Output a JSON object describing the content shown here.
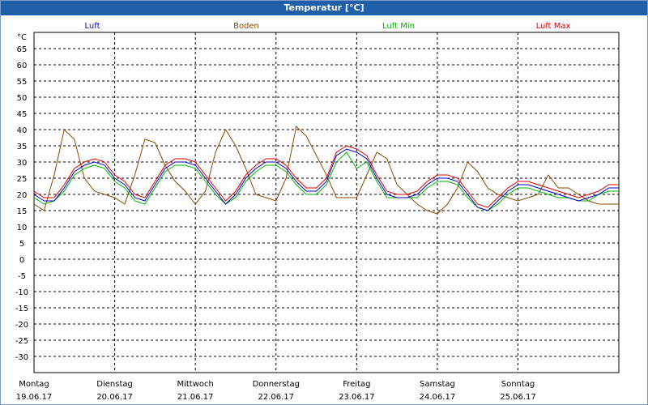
{
  "window": {
    "title": "Temperatur [°C]"
  },
  "colors": {
    "Luft": "#0000cc",
    "Boden": "#8b4a00",
    "Luft Min": "#00b400",
    "Luft Max": "#dd0000"
  },
  "chart_data": {
    "type": "line",
    "title": "Temperatur [°C]",
    "ylabel": "°C",
    "xlabel": "",
    "ylim": [
      -35,
      70
    ],
    "yticks": [
      65,
      60,
      55,
      50,
      45,
      40,
      35,
      30,
      25,
      20,
      15,
      10,
      5,
      0,
      -5,
      -10,
      -15,
      -20,
      -25,
      -30
    ],
    "grid": true,
    "legend_position": "top",
    "x_unit": "hours since Montag 19.06.17 00:00",
    "xlim": [
      0,
      174
    ],
    "days": [
      {
        "weekday": "Montag",
        "date": "19.06.17"
      },
      {
        "weekday": "Dienstag",
        "date": "20.06.17"
      },
      {
        "weekday": "Mittwoch",
        "date": "21.06.17"
      },
      {
        "weekday": "Donnerstag",
        "date": "22.06.17"
      },
      {
        "weekday": "Freitag",
        "date": "23.06.17"
      },
      {
        "weekday": "Samstag",
        "date": "24.06.17"
      },
      {
        "weekday": "Sonntag",
        "date": "25.06.17"
      }
    ],
    "series": [
      {
        "name": "Luft",
        "x": [
          0,
          3,
          6,
          9,
          12,
          15,
          18,
          21,
          24,
          27,
          30,
          33,
          36,
          39,
          42,
          45,
          48,
          51,
          54,
          57,
          60,
          63,
          66,
          69,
          72,
          75,
          78,
          81,
          84,
          87,
          90,
          93,
          96,
          99,
          102,
          105,
          108,
          111,
          114,
          117,
          120,
          123,
          126,
          129,
          132,
          135,
          138,
          141,
          144,
          147,
          150,
          153,
          156,
          159,
          162,
          165,
          168,
          171,
          174
        ],
        "y": [
          20,
          18,
          18,
          22,
          27,
          29,
          30,
          29,
          25,
          23,
          19,
          18,
          23,
          28,
          30,
          30,
          29,
          25,
          21,
          17,
          20,
          25,
          28,
          30,
          30,
          28,
          24,
          21,
          21,
          24,
          32,
          34,
          33,
          31,
          25,
          20,
          19,
          19,
          20,
          23,
          25,
          25,
          24,
          20,
          16,
          15,
          18,
          21,
          23,
          23,
          22,
          21,
          20,
          19,
          18,
          19,
          20,
          22,
          22
        ]
      },
      {
        "name": "Boden",
        "x": [
          0,
          3,
          6,
          9,
          12,
          15,
          18,
          21,
          24,
          27,
          30,
          33,
          36,
          39,
          42,
          45,
          48,
          51,
          54,
          57,
          60,
          63,
          66,
          69,
          72,
          75,
          78,
          81,
          84,
          87,
          90,
          93,
          96,
          99,
          102,
          105,
          108,
          111,
          114,
          117,
          120,
          123,
          126,
          129,
          132,
          135,
          138,
          141,
          144,
          147,
          150,
          153,
          156,
          159,
          162,
          165,
          168,
          171,
          174
        ],
        "y": [
          17,
          15,
          26,
          40,
          37,
          25,
          21,
          20,
          19,
          17,
          26,
          37,
          36,
          29,
          24,
          21,
          17,
          21,
          33,
          40,
          35,
          28,
          20,
          19,
          18,
          25,
          41,
          38,
          32,
          26,
          19,
          19,
          19,
          26,
          33,
          31,
          23,
          20,
          17,
          15,
          14,
          17,
          22,
          30,
          27,
          22,
          20,
          19,
          18,
          19,
          20,
          26,
          22,
          22,
          20,
          18,
          17,
          17,
          17
        ]
      },
      {
        "name": "Luft Min",
        "x": [
          0,
          3,
          6,
          9,
          12,
          15,
          18,
          21,
          24,
          27,
          30,
          33,
          36,
          39,
          42,
          45,
          48,
          51,
          54,
          57,
          60,
          63,
          66,
          69,
          72,
          75,
          78,
          81,
          84,
          87,
          90,
          93,
          96,
          99,
          102,
          105,
          108,
          111,
          114,
          117,
          120,
          123,
          126,
          129,
          132,
          135,
          138,
          141,
          144,
          147,
          150,
          153,
          156,
          159,
          162,
          165,
          168,
          171,
          174
        ],
        "y": [
          19,
          17,
          18,
          21,
          26,
          28,
          29,
          28,
          24,
          22,
          18,
          17,
          22,
          27,
          29,
          29,
          28,
          24,
          20,
          17,
          19,
          24,
          27,
          29,
          29,
          27,
          23,
          20,
          20,
          23,
          30,
          33,
          28,
          30,
          24,
          19,
          19,
          19,
          19,
          22,
          24,
          24,
          23,
          19,
          16,
          15,
          17,
          20,
          22,
          22,
          21,
          20,
          19,
          19,
          18,
          18,
          20,
          21,
          21
        ]
      },
      {
        "name": "Luft Max",
        "x": [
          0,
          3,
          6,
          9,
          12,
          15,
          18,
          21,
          24,
          27,
          30,
          33,
          36,
          39,
          42,
          45,
          48,
          51,
          54,
          57,
          60,
          63,
          66,
          69,
          72,
          75,
          78,
          81,
          84,
          87,
          90,
          93,
          96,
          99,
          102,
          105,
          108,
          111,
          114,
          117,
          120,
          123,
          126,
          129,
          132,
          135,
          138,
          141,
          144,
          147,
          150,
          153,
          156,
          159,
          162,
          165,
          168,
          171,
          174
        ],
        "y": [
          21,
          19,
          19,
          23,
          28,
          30,
          31,
          30,
          26,
          24,
          20,
          19,
          24,
          29,
          31,
          31,
          30,
          26,
          22,
          18,
          21,
          26,
          29,
          31,
          31,
          29,
          25,
          22,
          22,
          25,
          33,
          35,
          34,
          32,
          26,
          21,
          20,
          20,
          21,
          24,
          26,
          26,
          25,
          21,
          17,
          16,
          19,
          22,
          24,
          24,
          23,
          22,
          21,
          20,
          19,
          20,
          21,
          23,
          23
        ]
      }
    ]
  }
}
